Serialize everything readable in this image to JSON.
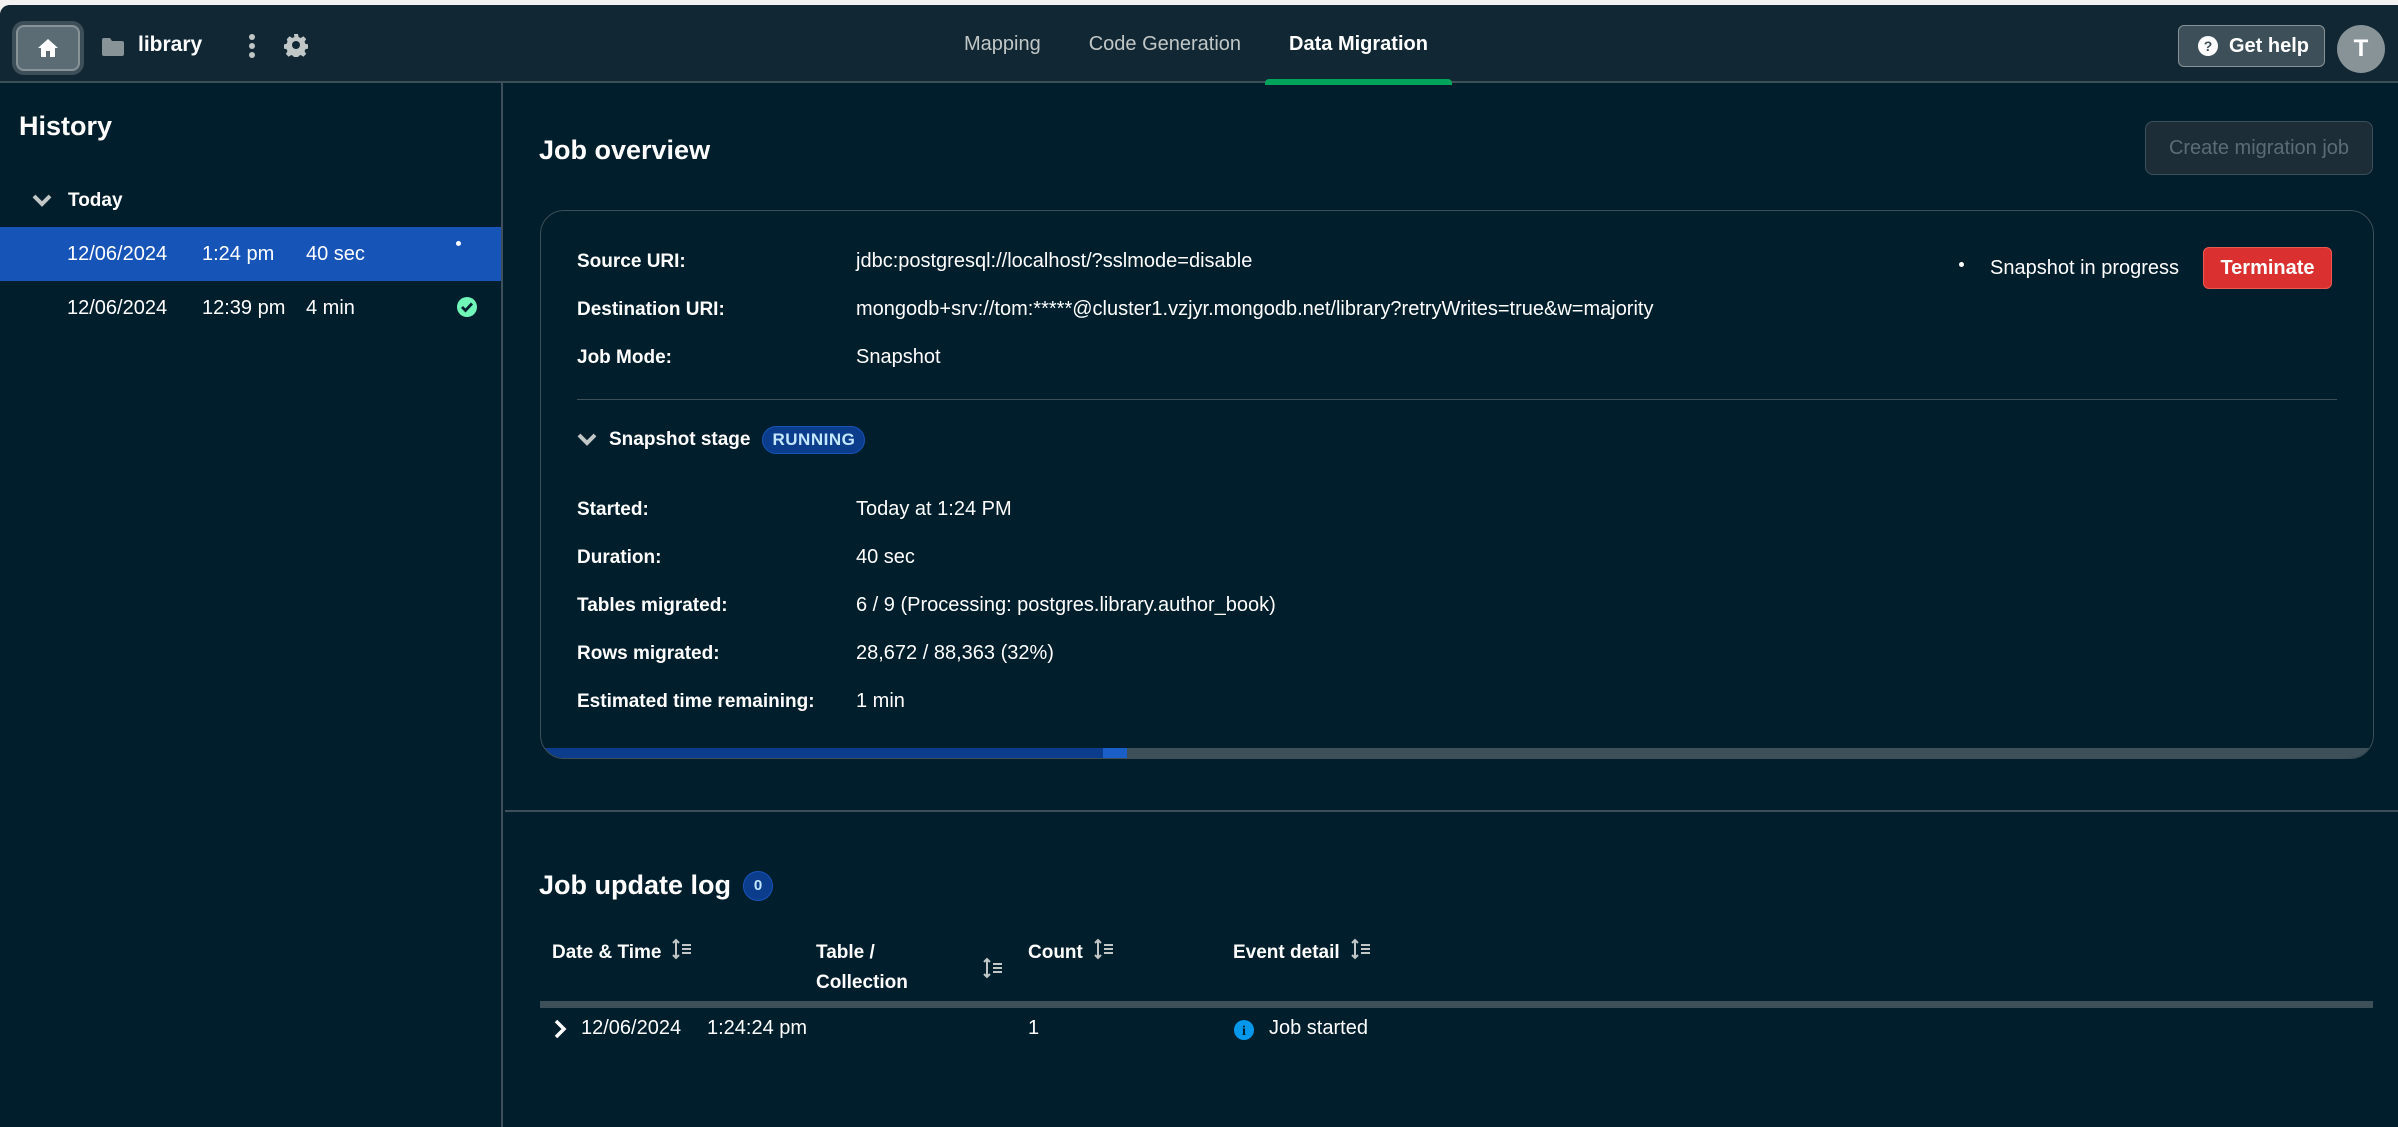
{
  "topbar": {
    "project_name": "library",
    "tabs": [
      {
        "label": "Mapping",
        "active": false
      },
      {
        "label": "Code Generation",
        "active": false
      },
      {
        "label": "Data Migration",
        "active": true
      }
    ],
    "help_label": "Get help",
    "avatar_initial": "T"
  },
  "sidebar": {
    "title": "History",
    "group_label": "Today",
    "items": [
      {
        "date": "12/06/2024",
        "time": "1:24 pm",
        "duration": "40 sec",
        "status": "running",
        "selected": true
      },
      {
        "date": "12/06/2024",
        "time": "12:39 pm",
        "duration": "4 min",
        "status": "completed",
        "selected": false
      }
    ]
  },
  "overview": {
    "title": "Job overview",
    "create_button": "Create migration job",
    "source_label": "Source URI:",
    "source_value": "jdbc:postgresql://localhost/?sslmode=disable",
    "dest_label": "Destination URI:",
    "dest_value": "mongodb+srv://tom:*****@cluster1.vzjyr.mongodb.net/library?retryWrites=true&w=majority",
    "mode_label": "Job Mode:",
    "mode_value": "Snapshot",
    "status_text": "Snapshot in progress",
    "terminate_label": "Terminate",
    "stage": {
      "title": "Snapshot stage",
      "badge": "RUNNING",
      "fields": [
        {
          "label": "Started:",
          "value": "Today at 1:24 PM"
        },
        {
          "label": "Duration:",
          "value": "40 sec"
        },
        {
          "label": "Tables migrated:",
          "value": "6 / 9 (Processing: postgres.library.author_book)"
        },
        {
          "label": "Rows migrated:",
          "value": "28,672 / 88,363 (32%)"
        },
        {
          "label": "Estimated time remaining:",
          "value": "1 min"
        }
      ],
      "progress_percent": 32
    }
  },
  "log": {
    "title": "Job update log",
    "count": "0",
    "columns": [
      "Date & Time",
      "Table / Collection",
      "Count",
      "Event detail"
    ],
    "col_table_line1": "Table /",
    "col_table_line2": "Collection",
    "rows": [
      {
        "date": "12/06/2024",
        "time": "1:24:24 pm",
        "table": "",
        "count": "1",
        "event": "Job started",
        "event_icon": "info-icon"
      }
    ]
  },
  "colors": {
    "background": "#001e2b",
    "accent_green": "#00a35c",
    "selected_blue": "#1654b8",
    "danger_red": "#db3030",
    "success_green": "#71f6ba",
    "info_blue": "#0498ec"
  }
}
